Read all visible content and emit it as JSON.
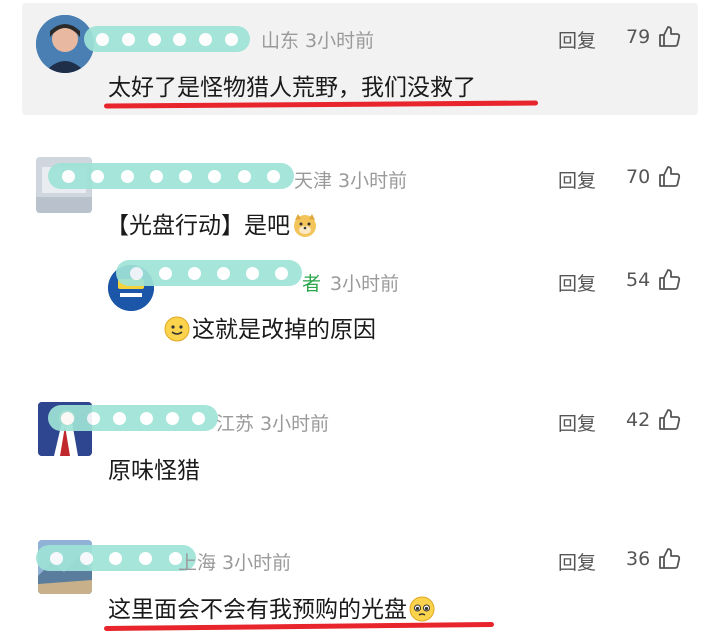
{
  "comments": [
    {
      "location_time": "山东 3小时前",
      "reply_label": "回复",
      "likes": "79",
      "text": "太好了是怪物猎人荒野，我们没救了"
    },
    {
      "location_time": "天津 3小时前",
      "reply_label": "回复",
      "likes": "70",
      "text": "【光盘行动】是吧"
    },
    {
      "author_tag": "者",
      "location_time": "3小时前",
      "reply_label": "回复",
      "likes": "54",
      "text": "这就是改掉的原因"
    },
    {
      "location_time": "江苏 3小时前",
      "reply_label": "回复",
      "likes": "42",
      "text": "原味怪猎"
    },
    {
      "location_time": "上海 3小时前",
      "reply_label": "回复",
      "likes": "36",
      "text": "这里面会不会有我预购的光盘"
    }
  ],
  "colors": {
    "blur": "#9fe3d7",
    "underline": "#e8242c",
    "meta": "#9a9a9a"
  },
  "icons": [
    "thumbs-up-icon",
    "doge-emoji",
    "smile-emoji",
    "pleading-emoji"
  ]
}
